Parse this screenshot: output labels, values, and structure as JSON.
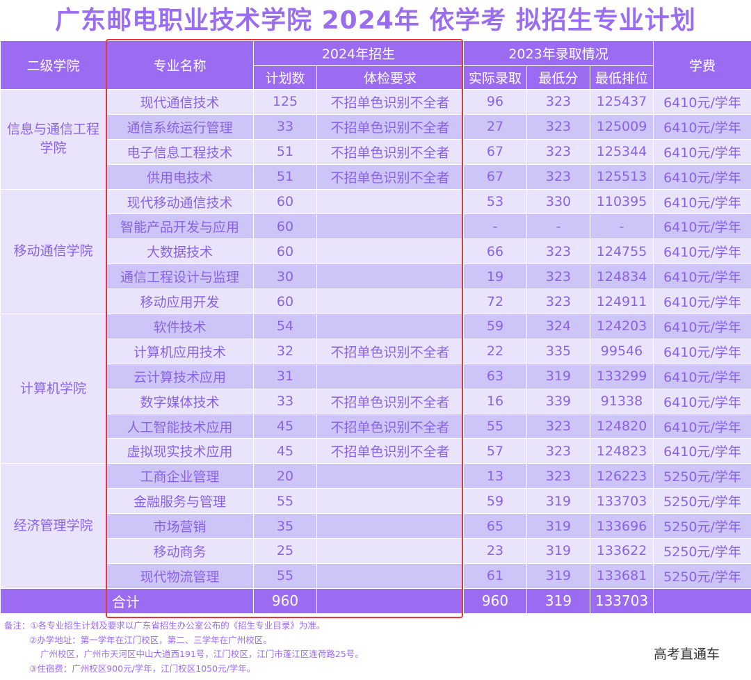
{
  "title": "广东邮电职业技术学院 2024年 依学考 拟招生专业计划",
  "headers": {
    "college": "二级学院",
    "major": "专业名称",
    "group_2024": "2024年招生",
    "plan": "计划数",
    "exam": "体检要求",
    "group_2023": "2023年录取情况",
    "admitted": "实际录取",
    "min_score": "最低分",
    "min_rank": "最低排位",
    "tuition": "学费"
  },
  "colleges": [
    {
      "name": "信息与通信工程学院"
    },
    {
      "name": "移动通信学院"
    },
    {
      "name": "计算机学院"
    },
    {
      "name": "经济管理学院"
    }
  ],
  "rows": [
    {
      "major": "现代通信技术",
      "plan": "125",
      "exam": "不招单色识别不全者",
      "admitted": "96",
      "min_score": "323",
      "min_rank": "125437",
      "tuition": "6410元/学年"
    },
    {
      "major": "通信系统运行管理",
      "plan": "33",
      "exam": "不招单色识别不全者",
      "admitted": "27",
      "min_score": "323",
      "min_rank": "125009",
      "tuition": "6410元/学年"
    },
    {
      "major": "电子信息工程技术",
      "plan": "51",
      "exam": "不招单色识别不全者",
      "admitted": "67",
      "min_score": "323",
      "min_rank": "125344",
      "tuition": "6410元/学年"
    },
    {
      "major": "供用电技术",
      "plan": "51",
      "exam": "不招单色识别不全者",
      "admitted": "67",
      "min_score": "323",
      "min_rank": "125513",
      "tuition": "6410元/学年"
    },
    {
      "major": "现代移动通信技术",
      "plan": "60",
      "exam": "",
      "admitted": "53",
      "min_score": "330",
      "min_rank": "110395",
      "tuition": "6410元/学年"
    },
    {
      "major": "智能产品开发与应用",
      "plan": "60",
      "exam": "",
      "admitted": "-",
      "min_score": "-",
      "min_rank": "-",
      "tuition": "6410元/学年"
    },
    {
      "major": "大数据技术",
      "plan": "60",
      "exam": "",
      "admitted": "66",
      "min_score": "323",
      "min_rank": "124755",
      "tuition": "6410元/学年"
    },
    {
      "major": "通信工程设计与监理",
      "plan": "30",
      "exam": "",
      "admitted": "19",
      "min_score": "323",
      "min_rank": "124834",
      "tuition": "6410元/学年"
    },
    {
      "major": "移动应用开发",
      "plan": "60",
      "exam": "",
      "admitted": "72",
      "min_score": "323",
      "min_rank": "124911",
      "tuition": "6410元/学年"
    },
    {
      "major": "软件技术",
      "plan": "54",
      "exam": "",
      "admitted": "59",
      "min_score": "324",
      "min_rank": "124203",
      "tuition": "6410元/学年"
    },
    {
      "major": "计算机应用技术",
      "plan": "32",
      "exam": "不招单色识别不全者",
      "admitted": "22",
      "min_score": "335",
      "min_rank": "99546",
      "tuition": "6410元/学年"
    },
    {
      "major": "云计算技术应用",
      "plan": "31",
      "exam": "",
      "admitted": "63",
      "min_score": "319",
      "min_rank": "133299",
      "tuition": "6410元/学年"
    },
    {
      "major": "数字媒体技术",
      "plan": "33",
      "exam": "不招单色识别不全者",
      "admitted": "16",
      "min_score": "339",
      "min_rank": "91338",
      "tuition": "6410元/学年"
    },
    {
      "major": "人工智能技术应用",
      "plan": "45",
      "exam": "不招单色识别不全者",
      "admitted": "55",
      "min_score": "323",
      "min_rank": "124820",
      "tuition": "6410元/学年"
    },
    {
      "major": "虚拟现实技术应用",
      "plan": "45",
      "exam": "不招单色识别不全者",
      "admitted": "57",
      "min_score": "323",
      "min_rank": "124823",
      "tuition": "6410元/学年"
    },
    {
      "major": "工商企业管理",
      "plan": "20",
      "exam": "",
      "admitted": "13",
      "min_score": "323",
      "min_rank": "126223",
      "tuition": "5250元/学年"
    },
    {
      "major": "金融服务与管理",
      "plan": "55",
      "exam": "",
      "admitted": "59",
      "min_score": "319",
      "min_rank": "133703",
      "tuition": "5250元/学年"
    },
    {
      "major": "市场营销",
      "plan": "35",
      "exam": "",
      "admitted": "65",
      "min_score": "319",
      "min_rank": "133696",
      "tuition": "5250元/学年"
    },
    {
      "major": "移动商务",
      "plan": "25",
      "exam": "",
      "admitted": "23",
      "min_score": "319",
      "min_rank": "133622",
      "tuition": "5250元/学年"
    },
    {
      "major": "现代物流管理",
      "plan": "55",
      "exam": "",
      "admitted": "61",
      "min_score": "319",
      "min_rank": "133681",
      "tuition": "5250元/学年"
    }
  ],
  "total": {
    "label": "合计",
    "plan": "960",
    "admitted": "960",
    "min_score": "319",
    "min_rank": "133703"
  },
  "notes": [
    "备注：①各专业招生计划及要求以广东省招生办公室公布的《招生专业目录》为准。",
    "②办学地址：第一学年在江门校区，第二、三学年在广州校区。",
    "广州校区，广州市天河区中山大道西191号，江门校区，江门市蓬江区连荷路25号。",
    "③住宿费：广州校区900元/学年，江门校区1050元/学年。"
  ],
  "watermark": "高考直通车",
  "colors": {
    "header_bg": "#9b6cf2",
    "row_light": "#e9e4fc",
    "row_dark": "#cdc5f8",
    "text": "#8a62e6",
    "highlight_border": "#e8333c"
  }
}
